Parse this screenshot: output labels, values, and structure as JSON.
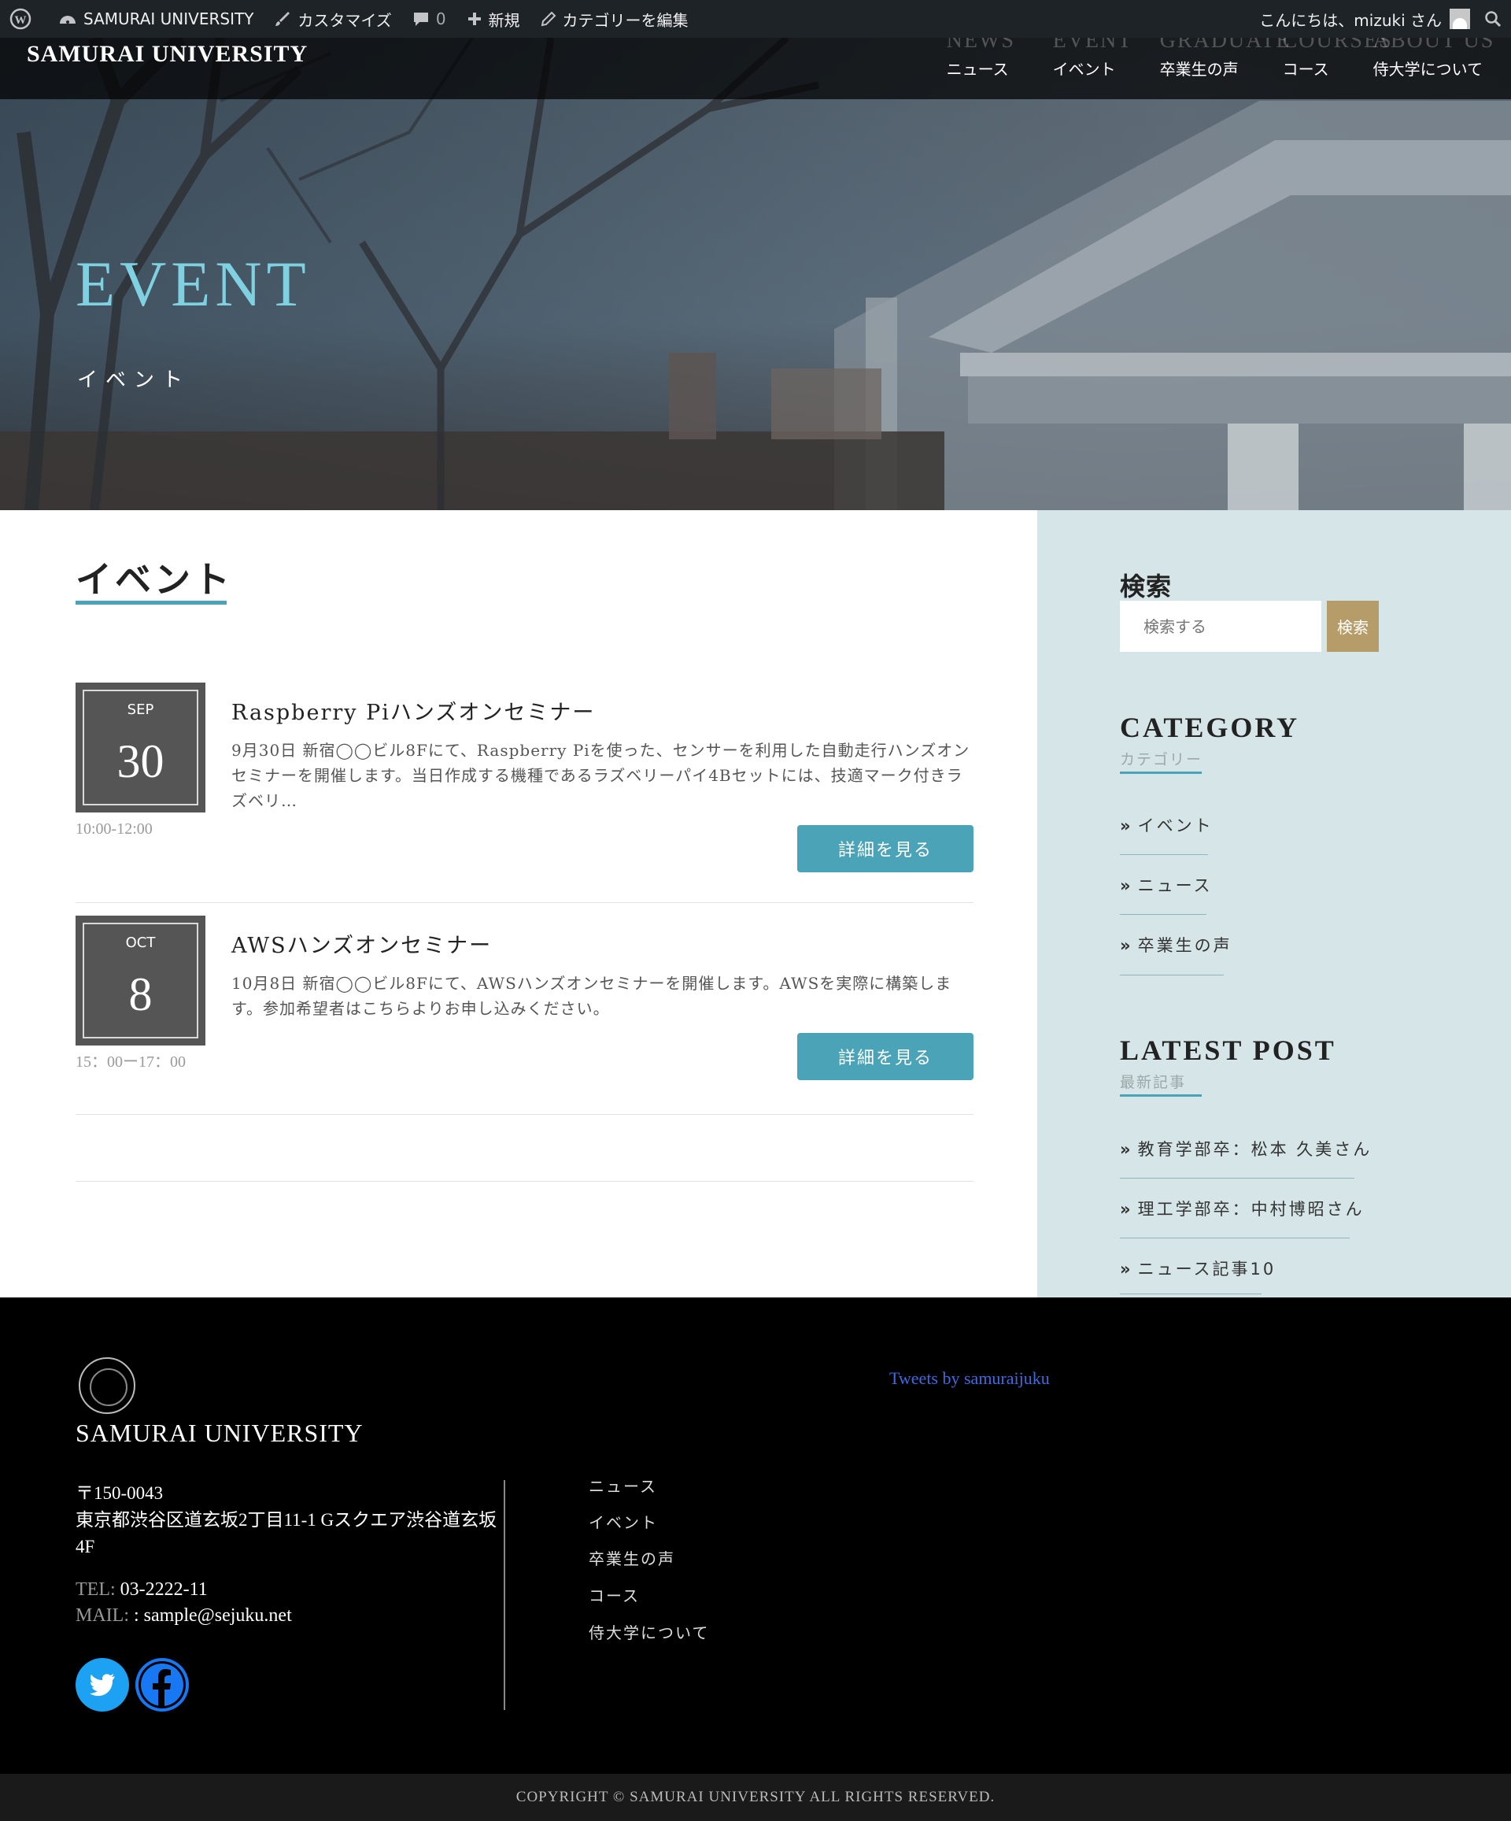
{
  "adminbar": {
    "site_name": "SAMURAI UNIVERSITY",
    "customize": "カスタマイズ",
    "comments_count": "0",
    "new": "新規",
    "edit_category": "カテゴリーを編集",
    "greeting": "こんにちは、mizuki さん"
  },
  "header": {
    "brand": "SAMURAI UNIVERSITY",
    "nav": [
      {
        "en": "NEWS",
        "ja": "ニュース"
      },
      {
        "en": "EVENT",
        "ja": "イベント"
      },
      {
        "en": "GRADUATE",
        "ja": "卒業生の声"
      },
      {
        "en": "COURSES",
        "ja": "コース"
      },
      {
        "en": "ABOUT US",
        "ja": "侍大学について"
      }
    ]
  },
  "hero": {
    "title": "EVENT",
    "subtitle": "イベント"
  },
  "main": {
    "page_title": "イベント",
    "events": [
      {
        "month": "SEP",
        "day": "30",
        "time": "10:00-12:00",
        "title": "Raspberry Piハンズオンセミナー",
        "excerpt": "9月30日 新宿◯◯ビル8Fにて、Raspberry Piを使った、センサーを利用した自動走行ハンズオンセミナーを開催します。当日作成する機種であるラズベリーパイ4Bセットには、技適マーク付きラズベリ…",
        "button": "詳細を見る"
      },
      {
        "month": "OCT",
        "day": "8",
        "time": "15：00ー17：00",
        "title": "AWSハンズオンセミナー",
        "excerpt": "10月8日 新宿◯◯ビル8Fにて、AWSハンズオンセミナーを開催します。AWSを実際に構築します。参加希望者はこちらよりお申し込みください。",
        "button": "詳細を見る"
      }
    ]
  },
  "sidebar": {
    "search_label": "検索",
    "search_placeholder": "検索する",
    "search_button": "検索",
    "category_title": "CATEGORY",
    "category_sub": "カテゴリー",
    "categories": [
      "イベント",
      "ニュース",
      "卒業生の声"
    ],
    "latest_title": "LATEST POST",
    "latest_sub": "最新記事",
    "latest": [
      "教育学部卒：松本 久美さん",
      "理工学部卒：中村博昭さん",
      "ニュース記事10"
    ]
  },
  "footer": {
    "brand": "SAMURAI UNIVERSITY",
    "postal": "〒150-0043",
    "address": "東京都渋谷区道玄坂2丁目11-1 Gスクエア渋谷道玄坂4F",
    "tel_label": "TEL:",
    "tel": "03-2222-11",
    "mail_label": "MAIL:",
    "mail": ": sample@sejuku.net",
    "nav": [
      "ニュース",
      "イベント",
      "卒業生の声",
      "コース",
      "侍大学について"
    ],
    "tweets": "Tweets by samuraijuku",
    "copyright": "COPYRIGHT © SAMURAI UNIVERSITY ALL RIGHTS RESERVED."
  },
  "colors": {
    "accent": "#4ba3b7",
    "search_button": "#b59c69",
    "sidebar_bg": "#d6e5e7",
    "twitter": "#1da1f2",
    "facebook": "#1877f2"
  }
}
